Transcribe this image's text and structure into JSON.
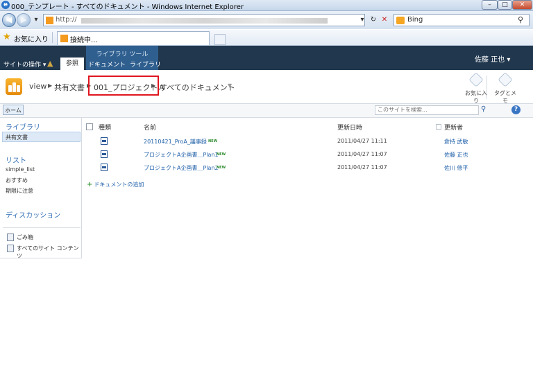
{
  "window": {
    "title": "000_テンプレート - すべてのドキュメント - Windows Internet Explorer",
    "ie_icon": "e",
    "minimize_icon": "–",
    "maximize_icon": "□",
    "close_icon": "✕"
  },
  "address_bar": {
    "url": "http://",
    "search_label": "Bing"
  },
  "favorites_bar": {
    "favorites_label": "お気に入り",
    "tab_label": "接続中..."
  },
  "ribbon": {
    "site_actions": "サイトの操作 ▾",
    "tab_browse": "参照",
    "context_group": "ライブラリ ツール",
    "tab_document": "ドキュメント",
    "tab_library": "ライブラリ",
    "user_name": "佐藤 正也 ▾"
  },
  "breadcrumb": {
    "root": "view",
    "library": "共有文書",
    "folder": "001_プロジェクトＡ",
    "view": "すべてのドキュメント"
  },
  "header_buttons": {
    "favorite": "お気に入り",
    "tags_notes": "タグとメモ"
  },
  "top_bar": {
    "home": "ホーム",
    "search_placeholder": "このサイトを検索..."
  },
  "quick_launch": {
    "libraries_heading": "ライブラリ",
    "shared_docs": "共有文書",
    "lists_heading": "リスト",
    "list_items": [
      "simple_list",
      "おすすめ",
      "期限に注意"
    ],
    "discussions_heading": "ディスカッション",
    "recycle_bin": "ごみ箱",
    "all_site_content": "すべてのサイト コンテンツ"
  },
  "doc_list": {
    "columns": {
      "type": "種類",
      "name": "名前",
      "modified": "更新日時",
      "modified_by": "更新者"
    },
    "new_badge": "NEW",
    "rows": [
      {
        "name": "20110421_ProA_議事録",
        "modified": "2011/04/27 11:11",
        "modified_by": "倉持 武敏"
      },
      {
        "name": "プロジェクトA企画書＿Plan1",
        "modified": "2011/04/27 11:07",
        "modified_by": "佐藤 正也"
      },
      {
        "name": "プロジェクトA企画書＿Plan2",
        "modified": "2011/04/27 11:07",
        "modified_by": "佐川 修平"
      }
    ],
    "add_document": "ドキュメントの追加"
  }
}
